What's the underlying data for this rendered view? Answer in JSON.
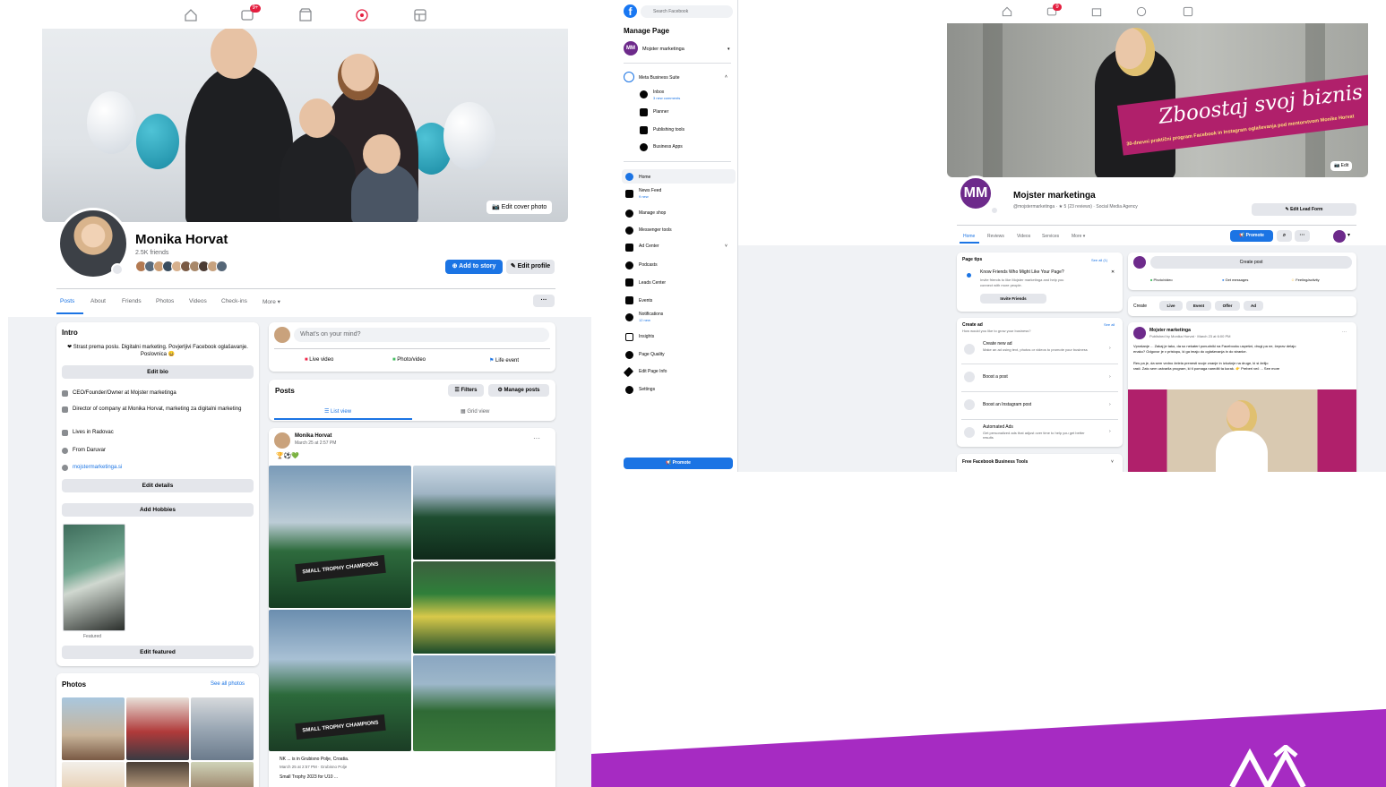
{
  "left": {
    "nav_badge": "9+",
    "cover_button": "Edit cover photo",
    "profile_name": "Monika Horvat",
    "friends_count": "2.5K friends",
    "add_story": "Add to story",
    "edit_profile": "Edit profile",
    "tabs": [
      "Posts",
      "About",
      "Friends",
      "Photos",
      "Videos",
      "Check-ins",
      "More ▾"
    ],
    "intro": {
      "title": "Intro",
      "bio": "❤ Strast prema poslu. Digitalni marketing. Povjerljivi Facebook oglašavanje. Poslovnica 😀",
      "edit_bio": "Edit bio",
      "items": [
        "CEO/Founder/Owner at Mojster marketinga",
        "Director of company at Monika Horvat, marketing za digitalni marketing",
        "Lives in Radovac",
        "From Daruvar",
        "mojstermarketinga.si"
      ],
      "edit_details": "Edit details",
      "add_hobbies": "Add Hobbies",
      "featured_caption": "Featured",
      "edit_featured": "Edit featured"
    },
    "composer": {
      "placeholder": "What's on your mind?",
      "live_video": "Live video",
      "photo_video": "Photo/video",
      "life_event": "Life event"
    },
    "posts": {
      "title": "Posts",
      "filters": "Filters",
      "manage": "Manage posts",
      "list_view": "List view",
      "grid_view": "Grid view"
    },
    "post": {
      "author": "Monika Horvat",
      "time": "March 25 at 2:57 PM",
      "emoji": "🏆⚽💚",
      "menu": "···",
      "banner_text": "SMALL TROPHY CHAMPIONS",
      "caption_1": "NK ... is in Grubisno Polje, Croatia.",
      "caption_2": "March 25 at 2:57 PM · Grubisno Polje",
      "caption_3": "Small Trophy 2023 for U10 ..."
    },
    "photos": {
      "title": "Photos",
      "see_all": "See all photos"
    }
  },
  "right": {
    "search_placeholder": "Search Facebook",
    "nav_badge": "9",
    "manage_page": "Manage Page",
    "page_switch": "Mojster marketinga",
    "business_suite": "Meta Business Suite",
    "suite_items": [
      {
        "label": "Inbox",
        "sub": "3 new comments"
      },
      {
        "label": "Planner",
        "sub": ""
      },
      {
        "label": "Publishing tools",
        "sub": ""
      },
      {
        "label": "Business Apps",
        "sub": ""
      }
    ],
    "menu_items": [
      {
        "label": "Home",
        "sub": ""
      },
      {
        "label": "News Feed",
        "sub": "9 new"
      },
      {
        "label": "Manage shop",
        "sub": ""
      },
      {
        "label": "Messenger tools",
        "sub": ""
      },
      {
        "label": "Ad Center",
        "sub": ""
      },
      {
        "label": "Podcasts",
        "sub": ""
      },
      {
        "label": "Leads Center",
        "sub": ""
      },
      {
        "label": "Events",
        "sub": ""
      },
      {
        "label": "Notifications",
        "sub": "12 new"
      },
      {
        "label": "Insights",
        "sub": ""
      },
      {
        "label": "Page Quality",
        "sub": ""
      },
      {
        "label": "Edit Page Info",
        "sub": ""
      },
      {
        "label": "Settings",
        "sub": ""
      }
    ],
    "promote": "Promote",
    "cover_slogan": "Zboostaj svoj biznis",
    "cover_sub": "30-dnevni praktični program Facebook in Instagram oglaševanja pod mentorstvom Monike Horvat",
    "cover_edit": "Edit",
    "logo_text": "MM",
    "page_name": "Mojster marketinga",
    "page_meta": "@mojstermarketinga · ★ 5 (23 reviews) · Social Media Agency",
    "edit_lead": "Edit Lead Form",
    "tabs": [
      "Home",
      "Reviews",
      "Videos",
      "Services",
      "More ▾"
    ],
    "promote_btn": "Promote",
    "page_tips": {
      "title": "Page tips",
      "see_all": "See all (1)",
      "tip_title": "Know Friends Who Might Like Your Page?",
      "tip_body_1": "Invite friends to like Mojster marketinga and help you",
      "tip_body_2": "connect with more people.",
      "invite": "Invite Friends"
    },
    "create_ad": {
      "title": "Create ad",
      "see_all": "See all",
      "subtitle": "How would you like to grow your business?",
      "items": [
        {
          "title": "Create new ad",
          "sub": "Make an ad using text, photos or videos to promote your business"
        },
        {
          "title": "Boost a post",
          "sub": ""
        },
        {
          "title": "Boost an Instagram post",
          "sub": ""
        },
        {
          "title": "Automated Ads",
          "sub": "Get personalized ads that adjust over time to help you get better results"
        }
      ]
    },
    "free_tools": "Free Facebook Business Tools",
    "create_post": "Create post",
    "composer_actions": [
      "Photo/video",
      "Get messages",
      "Feeling/activity"
    ],
    "create_row": {
      "label": "Create",
      "items": [
        "Live",
        "Event",
        "Offer",
        "Ad"
      ]
    },
    "post": {
      "author": "Mojster marketinga",
      "meta": "Published by Monika Horvat · March 23 at 6:00 PM",
      "text_1": "Vprašanje ... Zakaj je tako, da so nekateri ponudniki na Facebooku uspešni, drugi pa ne, čeprav delajo",
      "text_2": "enako? Odgovor je v pristopu, ki ga imajo do oglaševanja in do stranke.",
      "text_3": "Res pa je, da sem vedno želela prenesti svoje znanje in izkušnje na druge, ki si želijo",
      "text_4": "rasti. Zato sem ustvarila program, ki ti pomaga narediti ta korak. 👉 Preberi več ... See more"
    }
  }
}
